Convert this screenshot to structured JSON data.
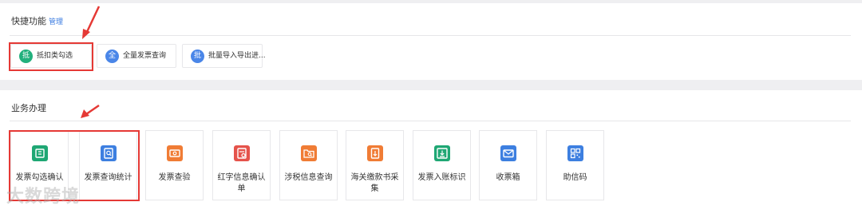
{
  "quick": {
    "title": "快捷功能",
    "manage": "管理",
    "items": [
      {
        "icon_text": "抵",
        "label": "抵扣类勾选",
        "color": "#22b07d"
      },
      {
        "icon_text": "全",
        "label": "全量发票查询",
        "color": "#4a86e8"
      },
      {
        "icon_text": "批",
        "label": "批量导入导出进...",
        "color": "#4a86e8"
      }
    ]
  },
  "business": {
    "title": "业务办理",
    "items": [
      {
        "label": "发票勾选确认",
        "icon": "ticket-check-icon",
        "color": "#1fa774"
      },
      {
        "label": "发票查询统计",
        "icon": "search-doc-icon",
        "color": "#3d7fe0"
      },
      {
        "label": "发票查验",
        "icon": "ticket-inspect-icon",
        "color": "#f07c35"
      },
      {
        "label": "红字信息确认单",
        "icon": "red-doc-icon",
        "color": "#e5534b"
      },
      {
        "label": "涉税信息查询",
        "icon": "folder-search-icon",
        "color": "#f07c35"
      },
      {
        "label": "海关缴款书采集",
        "icon": "customs-doc-icon",
        "color": "#f07c35"
      },
      {
        "label": "发票入账标识",
        "icon": "ledger-icon",
        "color": "#1fa774"
      },
      {
        "label": "收票箱",
        "icon": "mail-icon",
        "color": "#3d7fe0"
      },
      {
        "label": "助信码",
        "icon": "qr-code-icon",
        "color": "#3d7fe0"
      }
    ]
  },
  "watermark": "大数跨境",
  "colors": {
    "highlight": "#e53935",
    "link": "#3a7be0"
  }
}
